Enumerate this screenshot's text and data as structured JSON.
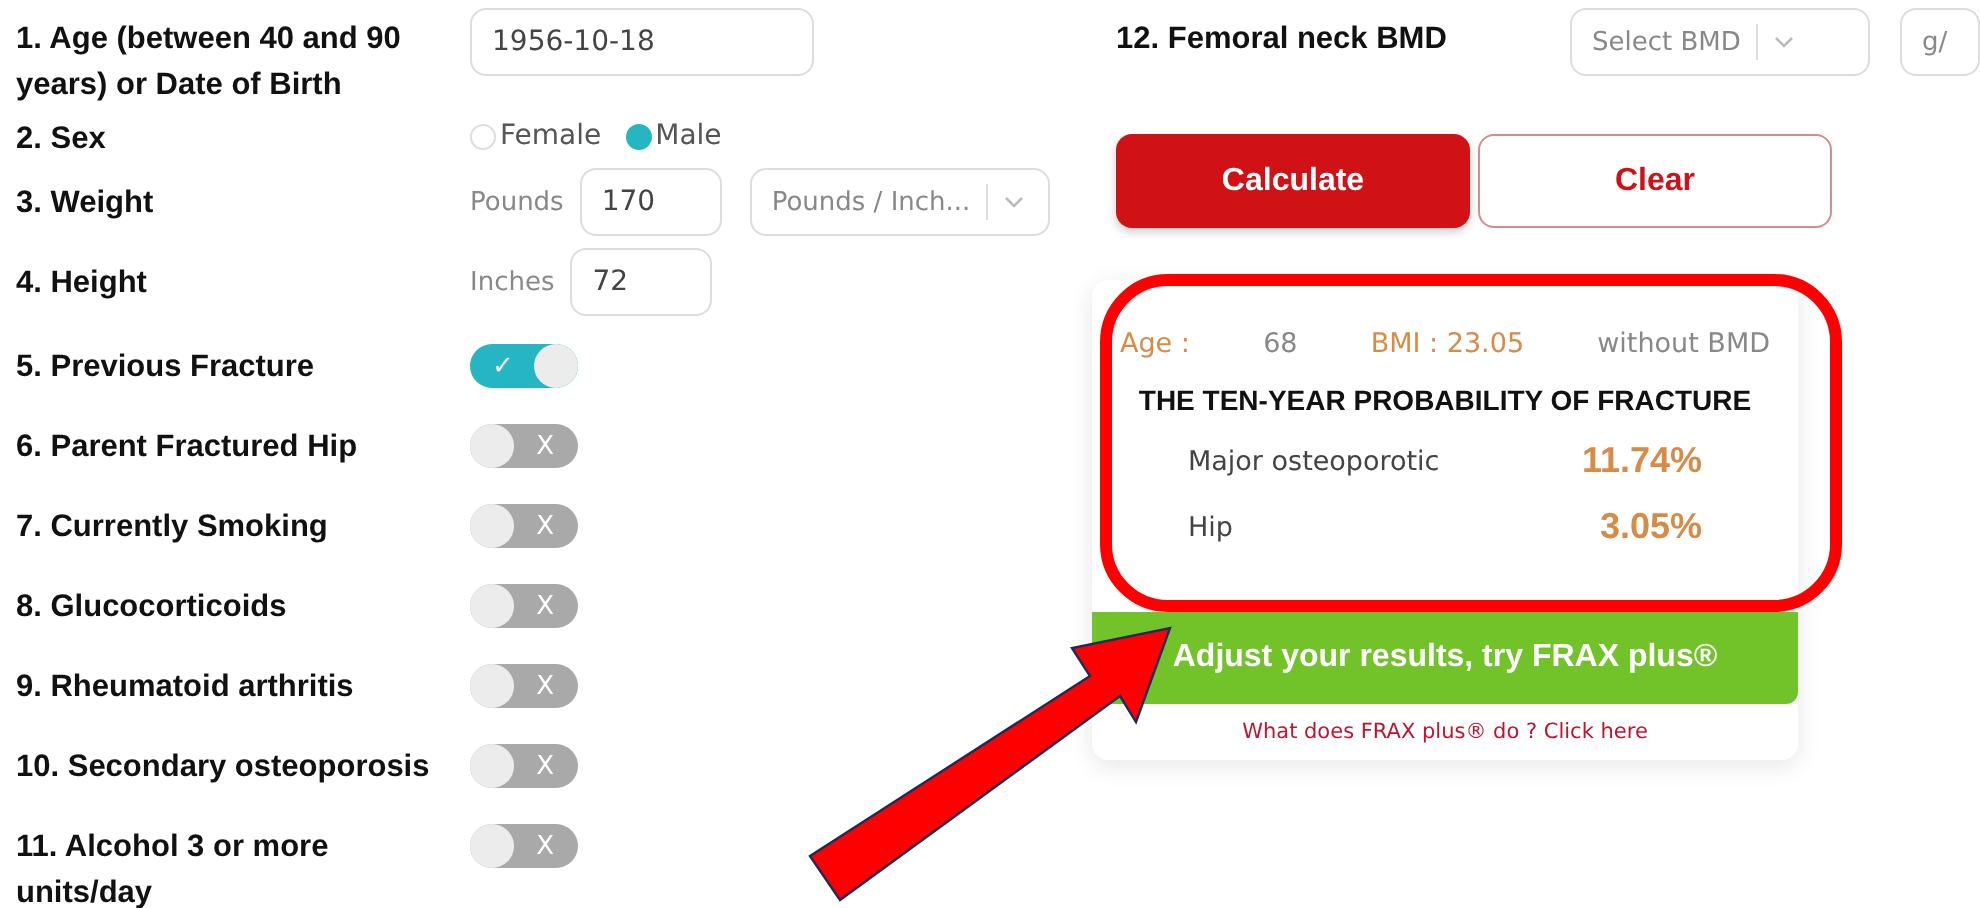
{
  "questions": [
    {
      "kind": "date",
      "label": "1. Age (between 40 and 90 years) or Date of Birth",
      "value": "1956-10-18"
    },
    {
      "kind": "radio",
      "label": "2. Sex",
      "options": [
        {
          "label": "Female",
          "selected": false
        },
        {
          "label": "Male",
          "selected": true
        }
      ]
    },
    {
      "kind": "weight",
      "label": "3. Weight",
      "unit": "Pounds",
      "value": "170",
      "unit_select": "Pounds / Inch..."
    },
    {
      "kind": "height",
      "label": "4. Height",
      "unit": "Inches",
      "value": "72"
    },
    {
      "kind": "toggle",
      "label": "5. Previous Fracture",
      "on": true,
      "glyph": "✓"
    },
    {
      "kind": "toggle",
      "label": "6. Parent Fractured Hip",
      "on": false,
      "glyph": "X"
    },
    {
      "kind": "toggle",
      "label": "7. Currently Smoking",
      "on": false,
      "glyph": "X"
    },
    {
      "kind": "toggle",
      "label": "8. Glucocorticoids",
      "on": false,
      "glyph": "X"
    },
    {
      "kind": "toggle",
      "label": "9. Rheumatoid arthritis",
      "on": false,
      "glyph": "X"
    },
    {
      "kind": "toggle",
      "label": "10. Secondary osteoporosis",
      "on": false,
      "glyph": "X"
    },
    {
      "kind": "toggle",
      "label": "11. Alcohol 3 or more units/day",
      "on": false,
      "glyph": "X"
    }
  ],
  "bmd": {
    "label": "12. Femoral neck BMD",
    "select_placeholder": "Select BMD",
    "unit_placeholder": "g/"
  },
  "buttons": [
    {
      "kind": "primary",
      "label": "Calculate"
    },
    {
      "kind": "secondary",
      "label": "Clear"
    }
  ],
  "result": {
    "age_label": "Age :",
    "age": "68",
    "bmi": "BMI : 23.05",
    "mode": "without BMD",
    "title": "THE TEN-YEAR PROBABILITY OF FRACTURE",
    "rows": [
      {
        "label": "Major osteoporotic",
        "value": "11.74%"
      },
      {
        "label": "Hip",
        "value": "3.05%"
      }
    ]
  },
  "frax_plus": {
    "button": "Adjust your results, try FRAX plus®",
    "link": "What does FRAX plus® do ? Click here"
  }
}
